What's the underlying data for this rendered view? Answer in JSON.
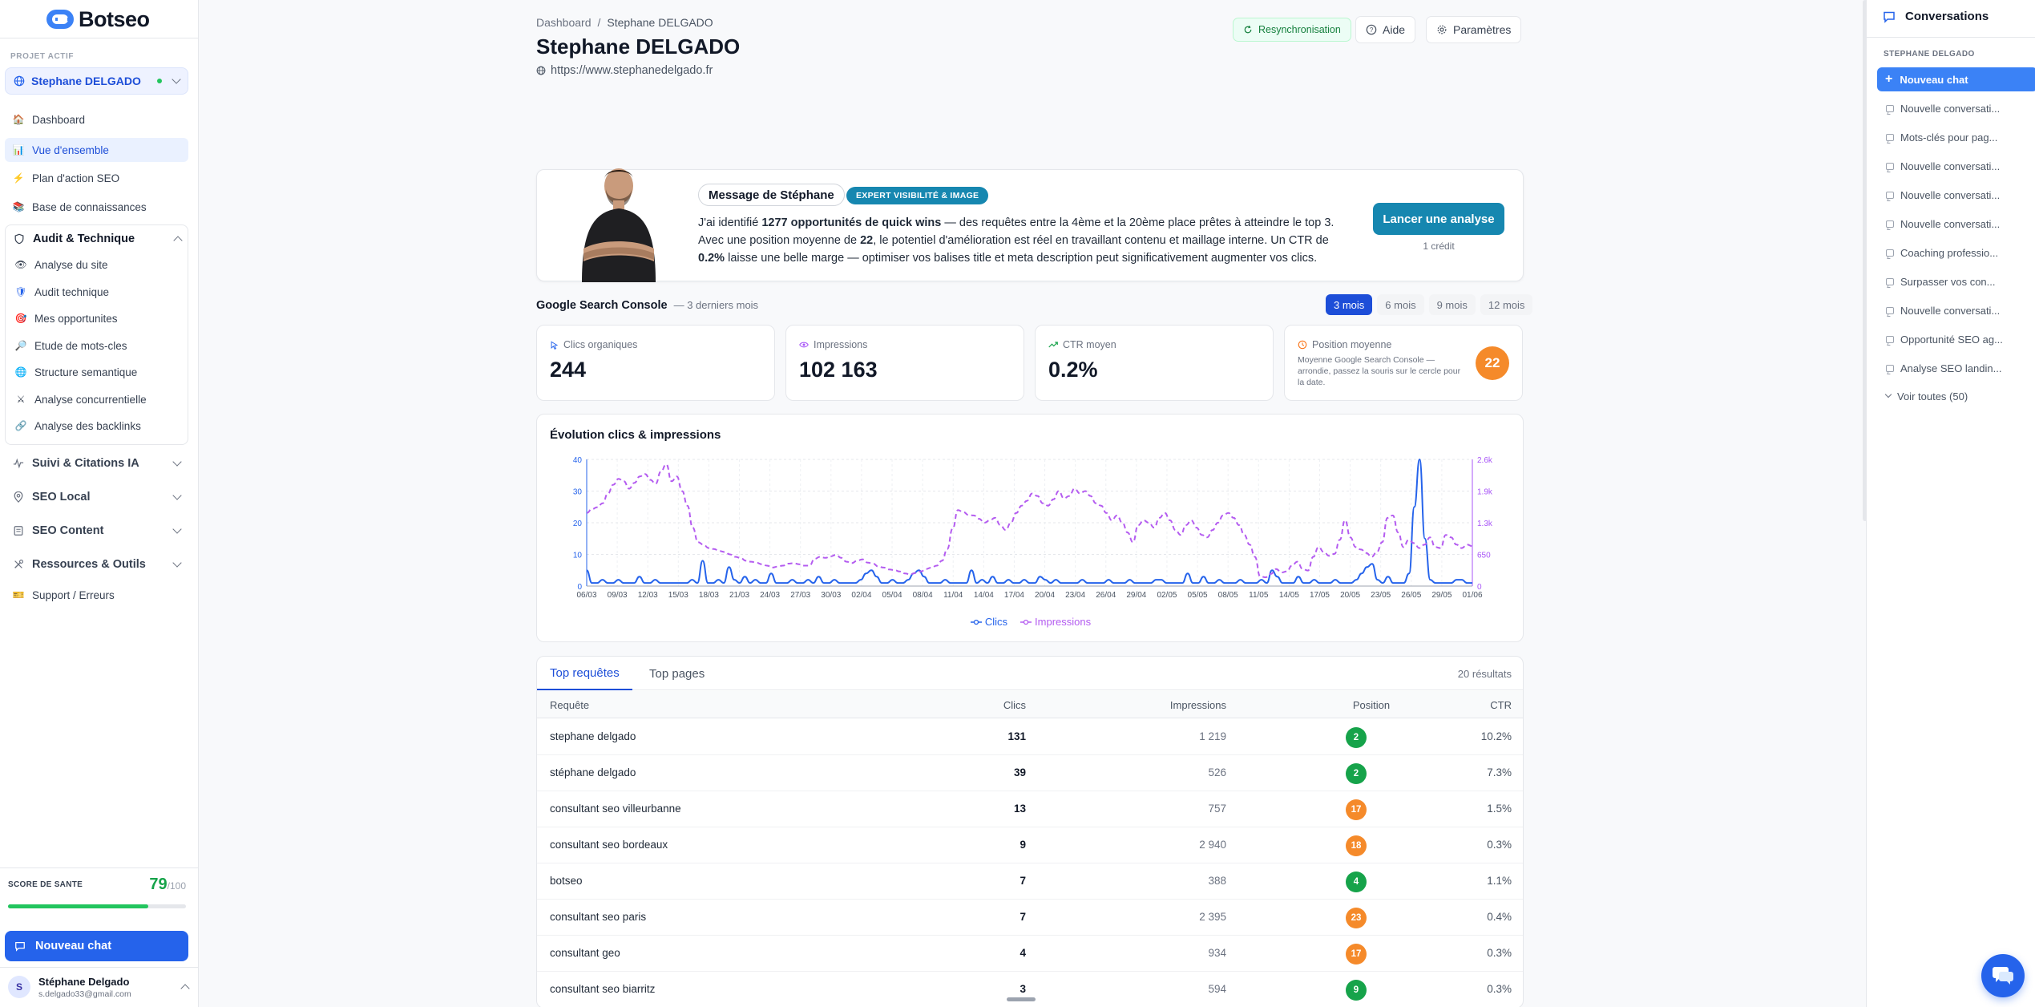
{
  "sidebar": {
    "logo": "Botseo",
    "project_label": "PROJET ACTIF",
    "project_name": "Stephane DELGADO",
    "nav": [
      {
        "label": "Dashboard",
        "icon": "house-icon"
      },
      {
        "label": "Vue d'ensemble",
        "icon": "bar-chart-icon"
      },
      {
        "label": "Plan d'action SEO",
        "icon": "lightning-icon"
      },
      {
        "label": "Base de connaissances",
        "icon": "books-icon"
      }
    ],
    "audit_group": {
      "title": "Audit & Technique",
      "items": [
        {
          "label": "Analyse du site",
          "icon": "eye-icon"
        },
        {
          "label": "Audit technique",
          "icon": "shield-icon"
        },
        {
          "label": "Mes opportunites",
          "icon": "target-icon"
        },
        {
          "label": "Etude de mots-cles",
          "icon": "magnifier-icon"
        },
        {
          "label": "Structure semantique",
          "icon": "globe-icon"
        },
        {
          "label": "Analyse concurrentielle",
          "icon": "crossed-swords-icon"
        },
        {
          "label": "Analyse des backlinks",
          "icon": "link-icon"
        }
      ]
    },
    "sections": [
      {
        "label": "Suivi & Citations IA",
        "icon": "activity-icon"
      },
      {
        "label": "SEO Local",
        "icon": "map-pin-icon"
      },
      {
        "label": "SEO Content",
        "icon": "document-icon"
      },
      {
        "label": "Ressources & Outils",
        "icon": "tools-icon"
      }
    ],
    "support": {
      "label": "Support / Erreurs",
      "icon": "ticket-icon"
    },
    "health": {
      "label": "SCORE DE SANTE",
      "score": "79",
      "max": "/100",
      "fraction": 0.79
    },
    "new_chat": "Nouveau chat",
    "user": {
      "initial": "S",
      "name": "Stéphane Delgado",
      "email": "s.delgado33@gmail.com"
    }
  },
  "header": {
    "breadcrumb": [
      "Dashboard",
      "/",
      "Stephane DELGADO"
    ],
    "title": "Stephane DELGADO",
    "url": "https://www.stephanedelgado.fr",
    "sync": "Resynchronisation",
    "help": "Aide",
    "settings": "Paramètres"
  },
  "message": {
    "title": "Message de Stéphane",
    "badge": "EXPERT VISIBILITÉ & IMAGE",
    "line1_pre": "J'ai identifié ",
    "line1_bold": "1277 opportunités de quick wins",
    "line1_post": " — des requêtes entre la 4ème et la 20ème place prêtes à atteindre le top 3.",
    "line2_pre": "Avec une position moyenne de ",
    "line2_bold": "22",
    "line2_post": ", le potentiel d'amélioration est réel en travaillant contenu et maillage interne. Un CTR de",
    "line3_bold": "0.2%",
    "line3_post": " laisse une belle marge — optimiser vos balises title et meta description peut significativement augmenter vos clics.",
    "cta": "Lancer une analyse",
    "credit": "1 crédit"
  },
  "gsc": {
    "title": "Google Search Console",
    "subtitle": "— 3 derniers mois",
    "periods": [
      "3 mois",
      "6 mois",
      "9 mois",
      "12 mois"
    ],
    "active_period": 0,
    "kpis": {
      "clicks": {
        "label": "Clics organiques",
        "value": "244",
        "icon": "cursor-icon"
      },
      "impressions": {
        "label": "Impressions",
        "value": "102 163",
        "icon": "eye-icon"
      },
      "ctr": {
        "label": "CTR moyen",
        "value": "0.2%",
        "icon": "trend-up-icon"
      },
      "position": {
        "label": "Position moyenne",
        "desc": "Moyenne Google Search Console — arrondie, passez la souris sur le cercle pour la date.",
        "value": "22",
        "icon": "clock-icon"
      }
    }
  },
  "chart_data": {
    "type": "line",
    "title": "Évolution clics & impressions",
    "x_ticks": [
      "06/03",
      "09/03",
      "12/03",
      "15/03",
      "18/03",
      "21/03",
      "24/03",
      "27/03",
      "30/03",
      "02/04",
      "05/04",
      "08/04",
      "11/04",
      "14/04",
      "17/04",
      "20/04",
      "23/04",
      "26/04",
      "29/04",
      "02/05",
      "05/05",
      "08/05",
      "11/05",
      "14/05",
      "17/05",
      "20/05",
      "23/05",
      "26/05",
      "29/05",
      "01/06"
    ],
    "y_left_ticks": [
      "0",
      "10",
      "20",
      "30",
      "40"
    ],
    "y_left_range": [
      0,
      40
    ],
    "y_right_ticks": [
      "0",
      "650",
      "1.3k",
      "1.9k",
      "2.6k"
    ],
    "y_right_range": [
      0,
      2600
    ],
    "grid": true,
    "series": [
      {
        "name": "Clics",
        "axis": "left",
        "color": "#2563eb",
        "style": "solid",
        "values": [
          5,
          1,
          1,
          2,
          1,
          1,
          2,
          1,
          1,
          1,
          3,
          1,
          1,
          2,
          1,
          1,
          1,
          1,
          1,
          1,
          2,
          1,
          8,
          1,
          1,
          2,
          1,
          6,
          2,
          1,
          3,
          1,
          2,
          1,
          1,
          4,
          1,
          1,
          1,
          2,
          1,
          1,
          2,
          1,
          3,
          1,
          1,
          2,
          1,
          1,
          1,
          1,
          2,
          4,
          5,
          3,
          1,
          1,
          2,
          1,
          1,
          2,
          4,
          5,
          3,
          1,
          1,
          1,
          2,
          1,
          1,
          1,
          1,
          5,
          1,
          2,
          1,
          3,
          1,
          1,
          2,
          1,
          1,
          2,
          1,
          1,
          3,
          2,
          1,
          2,
          1,
          1,
          1,
          1,
          2,
          1,
          1,
          1,
          1,
          2,
          1,
          1,
          1,
          2,
          1,
          1,
          1,
          1,
          2,
          2,
          1,
          1,
          1,
          1,
          4,
          1,
          1,
          3,
          1,
          1,
          2,
          1,
          1,
          1,
          2,
          1,
          1,
          1,
          2,
          1,
          5,
          3,
          1,
          1,
          1,
          3,
          1,
          1,
          2,
          1,
          1,
          1,
          2,
          1,
          1,
          1,
          2,
          4,
          6,
          7,
          2,
          1,
          3,
          1,
          1,
          1,
          4,
          25,
          40,
          15,
          2,
          1,
          1,
          1,
          1,
          2,
          2,
          1,
          1
        ]
      },
      {
        "name": "Impressions",
        "axis": "right",
        "color": "#b45cf0",
        "style": "dashed",
        "values": [
          1500,
          1580,
          1620,
          1700,
          1900,
          2080,
          2200,
          2150,
          2000,
          2120,
          2250,
          2300,
          2180,
          2100,
          2350,
          2500,
          2150,
          2250,
          1950,
          1650,
          1200,
          900,
          850,
          780,
          760,
          720,
          700,
          650,
          600,
          580,
          520,
          500,
          480,
          450,
          420,
          380,
          400,
          420,
          460,
          470,
          450,
          420,
          420,
          560,
          600,
          580,
          610,
          640,
          580,
          500,
          470,
          520,
          550,
          480,
          460,
          400,
          380,
          340,
          330,
          300,
          260,
          240,
          270,
          300,
          350,
          380,
          420,
          520,
          760,
          1180,
          1560,
          1520,
          1460,
          1450,
          1380,
          1300,
          1350,
          1400,
          1250,
          1150,
          1300,
          1500,
          1650,
          1750,
          1900,
          1850,
          1700,
          1650,
          1780,
          1950,
          1800,
          1850,
          2000,
          1900,
          1950,
          1850,
          1700,
          1650,
          1500,
          1350,
          1450,
          1300,
          1100,
          900,
          1250,
          1350,
          1300,
          1200,
          1400,
          1500,
          1350,
          1150,
          1050,
          1250,
          1350,
          1200,
          1050,
          1000,
          1150,
          1300,
          1450,
          1500,
          1400,
          1250,
          1050,
          850,
          600,
          200,
          180,
          250,
          350,
          280,
          300,
          420,
          500,
          350,
          320,
          600,
          800,
          700,
          620,
          660,
          950,
          1350,
          1000,
          800,
          750,
          680,
          600,
          700,
          900,
          1400,
          1450,
          1100,
          800,
          950,
          880,
          780,
          850,
          1000,
          800,
          780,
          1050,
          1000,
          850,
          780,
          850,
          820
        ]
      }
    ]
  },
  "table": {
    "tabs": [
      "Top requêtes",
      "Top pages"
    ],
    "active_tab": 0,
    "results": "20 résultats",
    "headers": [
      "Requête",
      "Clics",
      "Impressions",
      "Position",
      "CTR"
    ],
    "rows": [
      {
        "query": "stephane delgado",
        "clicks": "131",
        "impressions": "1 219",
        "position": "2",
        "pos_color": "#16a34a",
        "ctr": "10.2%"
      },
      {
        "query": "stéphane delgado",
        "clicks": "39",
        "impressions": "526",
        "position": "2",
        "pos_color": "#16a34a",
        "ctr": "7.3%"
      },
      {
        "query": "consultant seo villeurbanne",
        "clicks": "13",
        "impressions": "757",
        "position": "17",
        "pos_color": "#f58a2a",
        "ctr": "1.5%"
      },
      {
        "query": "consultant seo bordeaux",
        "clicks": "9",
        "impressions": "2 940",
        "position": "18",
        "pos_color": "#f58a2a",
        "ctr": "0.3%"
      },
      {
        "query": "botseo",
        "clicks": "7",
        "impressions": "388",
        "position": "4",
        "pos_color": "#16a34a",
        "ctr": "1.1%"
      },
      {
        "query": "consultant seo paris",
        "clicks": "7",
        "impressions": "2 395",
        "position": "23",
        "pos_color": "#f58a2a",
        "ctr": "0.4%"
      },
      {
        "query": "consultant geo",
        "clicks": "4",
        "impressions": "934",
        "position": "17",
        "pos_color": "#f58a2a",
        "ctr": "0.3%"
      },
      {
        "query": "consultant seo biarritz",
        "clicks": "3",
        "impressions": "594",
        "position": "9",
        "pos_color": "#16a34a",
        "ctr": "0.3%"
      }
    ]
  },
  "conversations": {
    "title": "Conversations",
    "project": "STEPHANE DELGADO",
    "new_chat": "Nouveau chat",
    "items": [
      "Nouvelle conversati...",
      "Mots-clés pour pag...",
      "Nouvelle conversati...",
      "Nouvelle conversati...",
      "Nouvelle conversati...",
      "Coaching professio...",
      "Surpasser vos con...",
      "Nouvelle conversati...",
      "Opportunité SEO ag...",
      "Analyse SEO landin..."
    ],
    "see_all": "Voir toutes (50)"
  },
  "colors": {
    "primary": "#2563eb",
    "teal": "#1687b0",
    "green": "#16a34a",
    "orange": "#f58a2a",
    "purple": "#b45cf0"
  }
}
